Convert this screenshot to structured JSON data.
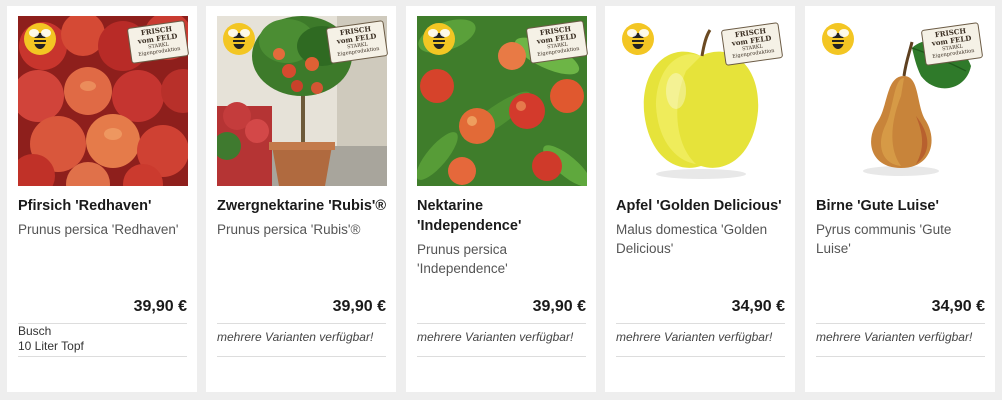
{
  "products": [
    {
      "title": "Pfirsich 'Redhaven'",
      "latin": "Prunus persica 'Redhaven'",
      "price": "39,90 €",
      "details": [
        "Busch",
        "10 Liter Topf"
      ],
      "badge_lines": [
        "FRISCH",
        "vom FELD",
        "STARKL",
        "Eigenproduktion"
      ],
      "image_icon": "peaches-photo"
    },
    {
      "title": "Zwergnektarine 'Rubis'®",
      "latin": "Prunus persica 'Rubis'®",
      "price": "39,90 €",
      "variant": "mehrere Varianten verfügbar!",
      "badge_lines": [
        "FRISCH",
        "vom FELD",
        "STARKL",
        "Eigenproduktion"
      ],
      "image_icon": "potted-nectarine-tree-photo"
    },
    {
      "title": "Nektarine 'Independence'",
      "latin": "Prunus persica 'Independence'",
      "price": "39,90 €",
      "variant": "mehrere Varianten verfügbar!",
      "badge_lines": [
        "FRISCH",
        "vom FELD",
        "STARKL",
        "Eigenproduktion"
      ],
      "image_icon": "nectarines-on-tree-photo"
    },
    {
      "title": "Apfel 'Golden Delicious'",
      "latin": "Malus domestica 'Golden Delicious'",
      "price": "34,90 €",
      "variant": "mehrere Varianten verfügbar!",
      "badge_lines": [
        "FRISCH",
        "vom FELD",
        "STARKL",
        "Eigenproduktion"
      ],
      "image_icon": "yellow-apple-photo"
    },
    {
      "title": "Birne 'Gute Luise'",
      "latin": "Pyrus communis 'Gute Luise'",
      "price": "34,90 €",
      "variant": "mehrere Varianten verfügbar!",
      "badge_lines": [
        "FRISCH",
        "vom FELD",
        "STARKL",
        "Eigenproduktion"
      ],
      "image_icon": "pear-photo"
    }
  ]
}
